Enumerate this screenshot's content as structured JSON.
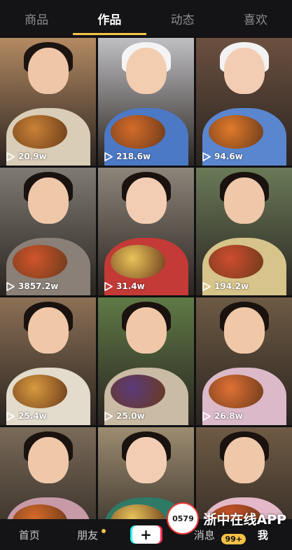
{
  "tabs": [
    "商品",
    "作品",
    "动态",
    "喜欢"
  ],
  "active_tab": 1,
  "videos": [
    {
      "views": "20.9w",
      "wall": "#b48a62",
      "skin": "#f0c6a8",
      "hair": "#1c1410",
      "body": "#d9cdb7",
      "food": "#c98236"
    },
    {
      "views": "218.6w",
      "wall": "#bfbfc3",
      "skin": "#f2cdb0",
      "hair": "#f4f4f4",
      "body": "#4c79c6",
      "food": "#d46b2a"
    },
    {
      "views": "94.6w",
      "wall": "#6b5040",
      "skin": "#f3cdb3",
      "hair": "#f2f2f2",
      "body": "#5a86d0",
      "food": "#e07a2b"
    },
    {
      "views": "3857.2w",
      "wall": "#7f7a72",
      "skin": "#efc7a9",
      "hair": "#1a120e",
      "body": "#8a8077",
      "food": "#d0542b"
    },
    {
      "views": "31.4w",
      "wall": "#8d857a",
      "skin": "#f3cdb3",
      "hair": "#1a120e",
      "body": "#c33a36",
      "food": "#e8c45a"
    },
    {
      "views": "194.2w",
      "wall": "#6a7a58",
      "skin": "#efc7a9",
      "hair": "#1a120e",
      "body": "#d6c48a",
      "food": "#cf4c2f"
    },
    {
      "views": "25.4w",
      "wall": "#8c7055",
      "skin": "#f0c8a8",
      "hair": "#1a120e",
      "body": "#e3dccd",
      "food": "#d89a3f"
    },
    {
      "views": "25.0w",
      "wall": "#5f7a46",
      "skin": "#f0c8a8",
      "hair": "#1a120e",
      "body": "#cabba5",
      "food": "#5b3a7a"
    },
    {
      "views": "26.8w",
      "wall": "#6e5a44",
      "skin": "#f0c8a8",
      "hair": "#1a120e",
      "body": "#dcb9c9",
      "food": "#e07035"
    },
    {
      "views": "",
      "wall": "#7a6a58",
      "skin": "#efc7a9",
      "hair": "#1a120e",
      "body": "#c79aa8",
      "food": "#d66a2a"
    },
    {
      "views": "",
      "wall": "#9c8c70",
      "skin": "#f3cdb3",
      "hair": "#1a120e",
      "body": "#2e7a66",
      "food": "#e8c45a"
    },
    {
      "views": "",
      "wall": "#6e5a44",
      "skin": "#efc7a9",
      "hair": "#1a120e",
      "body": "#e3b8c8",
      "food": "#d0542b"
    }
  ],
  "bottom_nav": {
    "home": "首页",
    "friends": "朋友",
    "plus": "+",
    "messages": "消息",
    "me": "我"
  },
  "watermark": {
    "logo": "0579",
    "text": "浙中在线APP",
    "badge": "99+"
  },
  "colors": {
    "accent": "#f6c245",
    "background": "#111113"
  }
}
